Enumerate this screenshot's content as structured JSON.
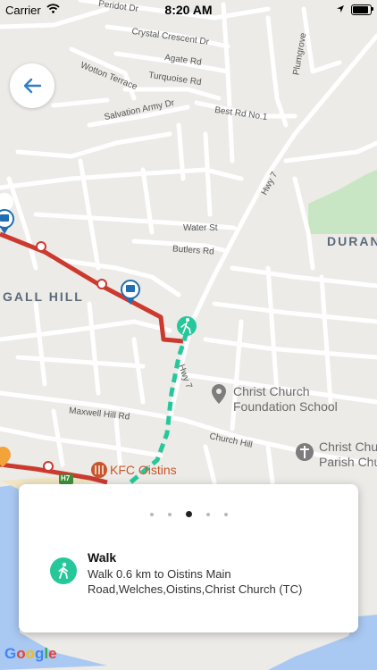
{
  "status_bar": {
    "carrier": "Carrier",
    "time": "8:20 AM",
    "battery_level": 1.0
  },
  "map": {
    "street_labels": {
      "peridot": "Peridot Dr",
      "crystal": "Crystal Crescent Dr",
      "agate": "Agate Rd",
      "wotton": "Wotton Terrace",
      "turquoise": "Turquoise Rd",
      "salvation": "Salvation Army Dr",
      "best": "Best Rd No.1",
      "plumgrove": "Plumgrove",
      "hwy7": "Hwy 7",
      "water": "Water St",
      "butlers": "Butlers Rd",
      "hwy7b": "Hwy 7",
      "maxwell": "Maxwell Hill Rd",
      "church": "Church Hill"
    },
    "area_labels": {
      "durants": "DURAN",
      "gall_hill": "GALL HILL"
    },
    "poi": {
      "school": "Christ Church\nFoundation School",
      "parish": "Christ Chu\nParish Chu",
      "kfc": "KFC Oistins",
      "h7_badge": "H7"
    },
    "attribution": "Google"
  },
  "colors": {
    "route_bus": "#cc3a2f",
    "route_walk": "#26c89b",
    "bus_stop_blue": "#1f6fb2",
    "poi_gray": "#7d7d7d",
    "kfc_orange": "#c8562b",
    "sea": "#a9c8f2",
    "park": "#c9e6c4"
  },
  "icons": {
    "back": "arrow-left-icon",
    "walk": "walking-person-icon",
    "bus_stop": "bus-stop-icon"
  },
  "step_card": {
    "pager_total": 5,
    "pager_active": 3,
    "title": "Walk",
    "description": "Walk 0.6 km to Oistins Main Road,Welches,Oistins,Christ Church (TC)"
  }
}
